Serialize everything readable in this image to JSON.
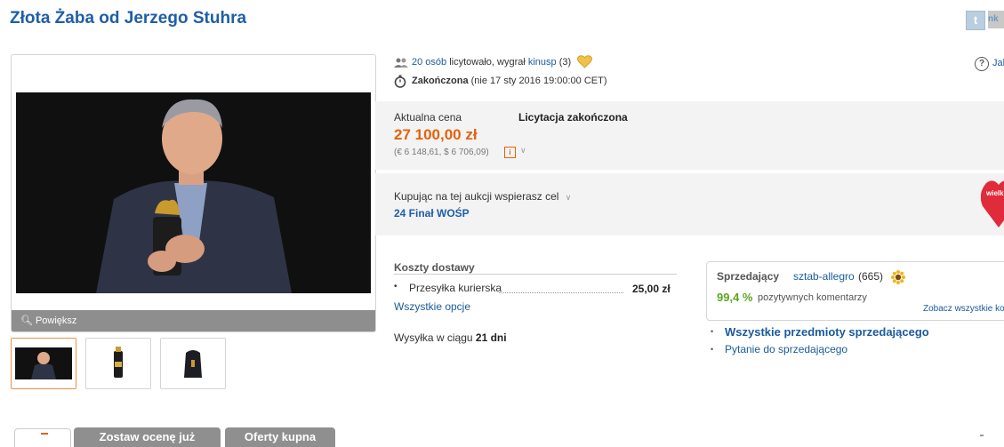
{
  "title": "Złota Żaba od Jerzego Stuhra",
  "social": {
    "twitter": "t",
    "nk": "nk"
  },
  "gallery": {
    "zoom_label": "Powiększ"
  },
  "bids": {
    "count_link": "20 osób",
    "text": " licytowało, wygrał ",
    "winner": "kinusp",
    "winner_score": "(3)"
  },
  "end": {
    "status": "Zakończona",
    "date": "(nie 17 sty 2016 19:00:00 CET)"
  },
  "help": {
    "icon": "?",
    "link": "Jak"
  },
  "price": {
    "label": "Aktualna cena",
    "value": "27 100,00 zł",
    "converted": "(€ 6 148,61, $ 6 706,09)",
    "info_icon": "i",
    "status": "Licytacja zakończona"
  },
  "charity": {
    "text": "Kupując na tej aukcji wspierasz cel",
    "name": "24 Finał WOŚP",
    "logo_text": "wielk świą p"
  },
  "shipping": {
    "title": "Koszty dostawy",
    "method": "Przesyłka kurierska",
    "price": "25,00 zł",
    "all_options": "Wszystkie opcje",
    "time_prefix": "Wysyłka w ciągu ",
    "time_value": "21 dni"
  },
  "seller": {
    "label": "Sprzedający",
    "name": "sztab-allegro",
    "count": "(665)",
    "positive_pct": "99,4 %",
    "positive_text": "pozytywnych komentarzy",
    "see_all": "Zobacz wszystkie ko",
    "all_items": "Wszystkie przedmioty sprzedającego",
    "ask": "Pytanie do sprzedającego"
  },
  "tabs": [
    "Zostaw ocenę już",
    "Oferty kupna"
  ]
}
